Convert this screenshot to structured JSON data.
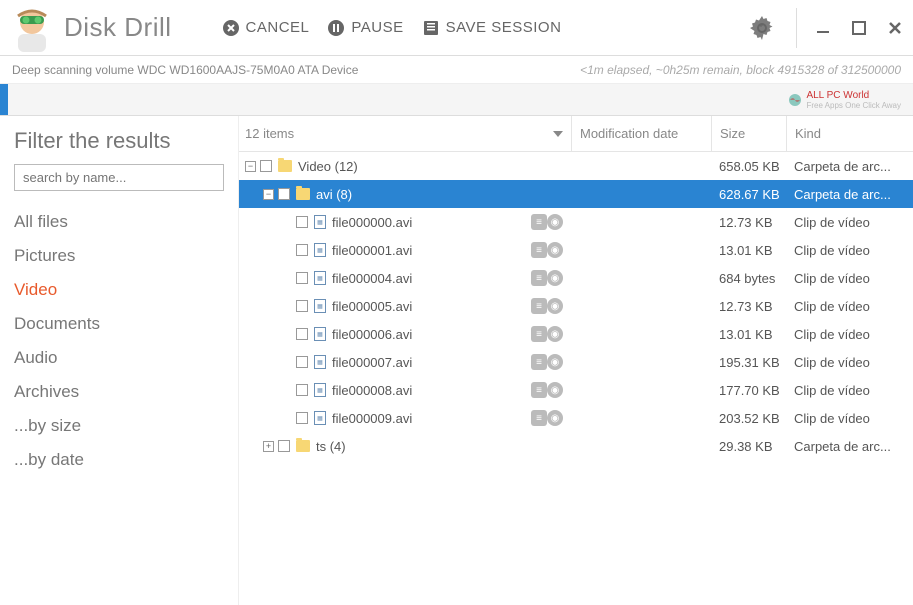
{
  "app": {
    "title": "Disk Drill"
  },
  "toolbar": {
    "cancel": "CANCEL",
    "pause": "PAUSE",
    "save_session": "SAVE SESSION"
  },
  "status": {
    "left": "Deep scanning volume WDC WD1600AAJS-75M0A0 ATA Device",
    "right": "<1m elapsed, ~0h25m remain, block 4915328 of 312500000"
  },
  "watermark": {
    "text": "ALL PC World",
    "sub": "Free Apps One Click Away"
  },
  "sidebar": {
    "title": "Filter the results",
    "search_placeholder": "search by name...",
    "items": [
      "All files",
      "Pictures",
      "Video",
      "Documents",
      "Audio",
      "Archives",
      "...by size",
      "...by date"
    ],
    "active_index": 2
  },
  "columns": {
    "items": "12 items",
    "mod": "Modification date",
    "size": "Size",
    "kind": "Kind"
  },
  "tree": [
    {
      "indent": 0,
      "toggle": "-",
      "type": "folder",
      "name": "Video  (12)",
      "size": "658.05 KB",
      "kind": "Carpeta de arc...",
      "selected": false,
      "actions": false
    },
    {
      "indent": 1,
      "toggle": "-",
      "type": "folder",
      "name": "avi (8)",
      "size": "628.67 KB",
      "kind": "Carpeta de arc...",
      "selected": true,
      "actions": false
    },
    {
      "indent": 2,
      "toggle": "",
      "type": "file",
      "name": "file000000.avi",
      "size": "12.73 KB",
      "kind": "Clip de vídeo",
      "selected": false,
      "actions": true
    },
    {
      "indent": 2,
      "toggle": "",
      "type": "file",
      "name": "file000001.avi",
      "size": "13.01 KB",
      "kind": "Clip de vídeo",
      "selected": false,
      "actions": true
    },
    {
      "indent": 2,
      "toggle": "",
      "type": "file",
      "name": "file000004.avi",
      "size": "684 bytes",
      "kind": "Clip de vídeo",
      "selected": false,
      "actions": true
    },
    {
      "indent": 2,
      "toggle": "",
      "type": "file",
      "name": "file000005.avi",
      "size": "12.73 KB",
      "kind": "Clip de vídeo",
      "selected": false,
      "actions": true
    },
    {
      "indent": 2,
      "toggle": "",
      "type": "file",
      "name": "file000006.avi",
      "size": "13.01 KB",
      "kind": "Clip de vídeo",
      "selected": false,
      "actions": true
    },
    {
      "indent": 2,
      "toggle": "",
      "type": "file",
      "name": "file000007.avi",
      "size": "195.31 KB",
      "kind": "Clip de vídeo",
      "selected": false,
      "actions": true
    },
    {
      "indent": 2,
      "toggle": "",
      "type": "file",
      "name": "file000008.avi",
      "size": "177.70 KB",
      "kind": "Clip de vídeo",
      "selected": false,
      "actions": true
    },
    {
      "indent": 2,
      "toggle": "",
      "type": "file",
      "name": "file000009.avi",
      "size": "203.52 KB",
      "kind": "Clip de vídeo",
      "selected": false,
      "actions": true
    },
    {
      "indent": 1,
      "toggle": "+",
      "type": "folder",
      "name": "ts  (4)",
      "size": "29.38 KB",
      "kind": "Carpeta de arc...",
      "selected": false,
      "actions": false
    }
  ]
}
